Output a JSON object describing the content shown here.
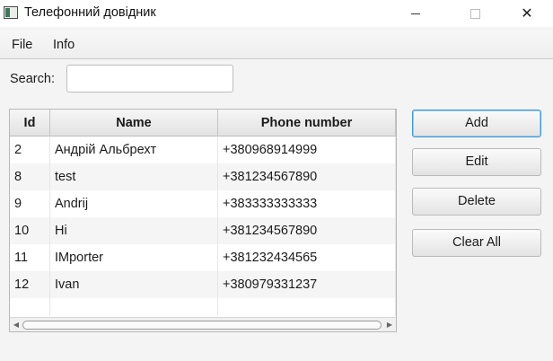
{
  "window": {
    "title": "Телефонний довідник",
    "min_glyph": "",
    "close_glyph": "✕"
  },
  "menu": {
    "items": [
      {
        "label": "File"
      },
      {
        "label": "Info"
      }
    ]
  },
  "search": {
    "label": "Search:",
    "value": "",
    "placeholder": ""
  },
  "table": {
    "columns": [
      "Id",
      "Name",
      "Phone number"
    ],
    "rows": [
      {
        "id": "2",
        "name": "Андрій Альбрехт",
        "phone": "+380968914999"
      },
      {
        "id": "8",
        "name": "test",
        "phone": "+381234567890"
      },
      {
        "id": "9",
        "name": "Andrij",
        "phone": "+383333333333"
      },
      {
        "id": "10",
        "name": "Hi",
        "phone": "+381234567890"
      },
      {
        "id": "11",
        "name": "IMporter",
        "phone": "+381232434565"
      },
      {
        "id": "12",
        "name": "Ivan",
        "phone": "+380979331237"
      }
    ],
    "scroll_left_glyph": "◀",
    "scroll_right_glyph": "▶"
  },
  "buttons": {
    "add": "Add",
    "edit": "Edit",
    "delete": "Delete",
    "clear_all": "Clear All"
  },
  "colors": {
    "accent": "#3c97d8",
    "background": "#f4f4f4"
  }
}
